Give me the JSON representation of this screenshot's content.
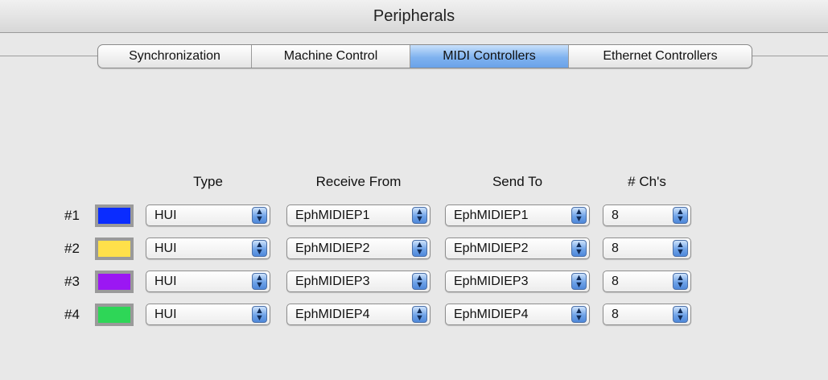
{
  "window": {
    "title": "Peripherals"
  },
  "tabs": [
    {
      "label": "Synchronization",
      "active": false
    },
    {
      "label": "Machine Control",
      "active": false
    },
    {
      "label": "MIDI Controllers",
      "active": true
    },
    {
      "label": "Ethernet Controllers",
      "active": false
    }
  ],
  "headers": {
    "type": "Type",
    "receive_from": "Receive From",
    "send_to": "Send To",
    "channels": "# Ch's"
  },
  "rows": [
    {
      "label": "#1",
      "color": "#0a2cff",
      "type": "HUI",
      "receive_from": "EphMIDIEP1",
      "send_to": "EphMIDIEP1",
      "channels": "8"
    },
    {
      "label": "#2",
      "color": "#ffe04a",
      "type": "HUI",
      "receive_from": "EphMIDIEP2",
      "send_to": "EphMIDIEP2",
      "channels": "8"
    },
    {
      "label": "#3",
      "color": "#9b17f3",
      "type": "HUI",
      "receive_from": "EphMIDIEP3",
      "send_to": "EphMIDIEP3",
      "channels": "8"
    },
    {
      "label": "#4",
      "color": "#2ed657",
      "type": "HUI",
      "receive_from": "EphMIDIEP4",
      "send_to": "EphMIDIEP4",
      "channels": "8"
    }
  ],
  "icons": {
    "popup_arrow": "up-down-arrows-icon"
  }
}
